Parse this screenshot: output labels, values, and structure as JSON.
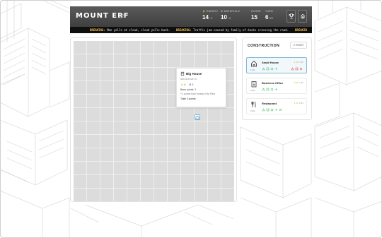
{
  "header": {
    "title": "MOUNT ERF",
    "stats": [
      {
        "label": "ENERGY",
        "value": "14",
        "sub": "/ 5"
      },
      {
        "label": "MATERIALS",
        "value": "10",
        "sub": "/ 5"
      },
      {
        "label": "SCORE",
        "value": "15",
        "sub": ""
      },
      {
        "label": "TURN",
        "value": "6",
        "sub": "/20"
      }
    ]
  },
  "ticker": {
    "items": [
      {
        "tag": "BREAKING:",
        "text": "Man yells at cloud, cloud yells back."
      },
      {
        "tag": "BREAKING:",
        "text": "Traffic jam caused by family of ducks crossing the road."
      },
      {
        "tag": "BREAKIN",
        "text": ""
      }
    ]
  },
  "tooltip": {
    "title": "Big House",
    "address": "Ash Avenue 10",
    "energy": "4",
    "materials": "3",
    "base": "Base points: 2",
    "bonus": "+1 points from nearby City Park",
    "total": "Total: 3 points"
  },
  "panel": {
    "title": "CONSTRUCTION",
    "reset_label": "RESET",
    "cards": [
      {
        "name": "Small House",
        "cost": "1 pts",
        "meta": "1 ⚡2 ⚙2",
        "icon": "house-icon"
      },
      {
        "name": "Business Office",
        "cost": "2 pts",
        "meta": "2 ⚡1 ⚙2",
        "icon": "office-icon"
      },
      {
        "name": "Restaurant",
        "cost": "2 pts",
        "meta": "1 ⚡3 ⚙1",
        "icon": "restaurant-icon"
      }
    ]
  },
  "colors": {
    "accent_green": "#4fc173",
    "accent_red": "#e05555",
    "selected_border": "#7fb7d6",
    "ticker_tag": "#f2c14e"
  }
}
